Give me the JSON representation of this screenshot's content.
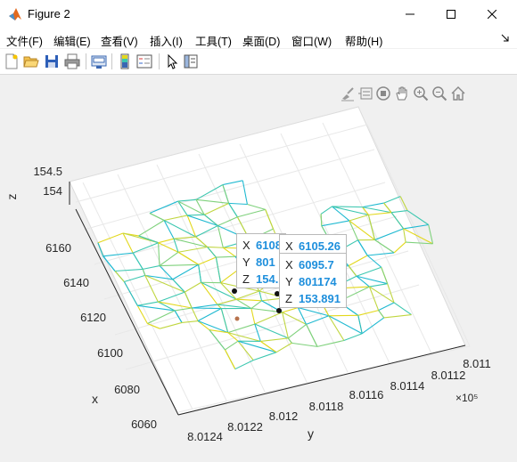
{
  "window": {
    "title": "Figure 2"
  },
  "menu": [
    "文件(F)",
    "编辑(E)",
    "查看(V)",
    "插入(I)",
    "工具(T)",
    "桌面(D)",
    "窗口(W)",
    "帮助(H)"
  ],
  "toolbar": {
    "icons": [
      "new-figure-icon",
      "open-file-icon",
      "save-icon",
      "print-icon",
      "link-plot-icon",
      "insert-colorbar-icon",
      "insert-legend-icon",
      "edit-plot-icon",
      "property-inspector-icon"
    ]
  },
  "axes_toolbar": [
    "brush-icon",
    "data-tips-icon",
    "rotate-3d-icon",
    "pan-icon",
    "zoom-in-icon",
    "zoom-out-icon",
    "restore-view-icon"
  ],
  "datatips": [
    {
      "x": "6108",
      "y": "801",
      "z": "154."
    },
    {
      "x": "6105.26",
      "y": "",
      "z": ""
    },
    {
      "x": "6095.7",
      "y": "801174",
      "z": "153.891"
    }
  ],
  "datatip_labels": {
    "x": "X",
    "y": "Y",
    "z": "Z"
  },
  "chart_data": {
    "type": "3d-mesh",
    "xlabel": "x",
    "ylabel": "y",
    "zlabel": "z",
    "x_ticks": [
      "6060",
      "6080",
      "6100",
      "6120",
      "6140",
      "6160"
    ],
    "y_ticks": [
      "8.0124",
      "8.0122",
      "8.012",
      "8.0118",
      "8.0116",
      "8.0114",
      "8.0112",
      "8.011"
    ],
    "y_exponent": "×10⁵",
    "z_ticks": [
      "154",
      "154.5"
    ],
    "colormap": [
      "#1fb9d1",
      "#3cc7b0",
      "#7fd17c",
      "#c0d640",
      "#e3d81c"
    ]
  }
}
